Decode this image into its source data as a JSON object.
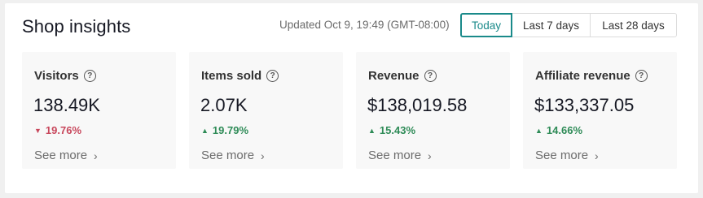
{
  "header": {
    "title": "Shop insights",
    "updated": "Updated Oct 9, 19:49 (GMT-08:00)"
  },
  "range": {
    "options": [
      "Today",
      "Last 7 days",
      "Last 28 days"
    ],
    "selected": "Today"
  },
  "cards": [
    {
      "label": "Visitors",
      "value": "138.49K",
      "change": "19.76%",
      "trend": "down",
      "see_more": "See more"
    },
    {
      "label": "Items sold",
      "value": "2.07K",
      "change": "19.79%",
      "trend": "up",
      "see_more": "See more"
    },
    {
      "label": "Revenue",
      "value": "$138,019.58",
      "change": "15.43%",
      "trend": "up",
      "see_more": "See more"
    },
    {
      "label": "Affiliate revenue",
      "value": "$133,337.05",
      "change": "14.66%",
      "trend": "up",
      "see_more": "See more"
    }
  ],
  "icons": {
    "help": "?",
    "down": "▼",
    "up": "▲",
    "chevron": "›"
  },
  "colors": {
    "accent": "#1a8a8a",
    "down": "#c8475c",
    "up": "#2e8b57"
  }
}
